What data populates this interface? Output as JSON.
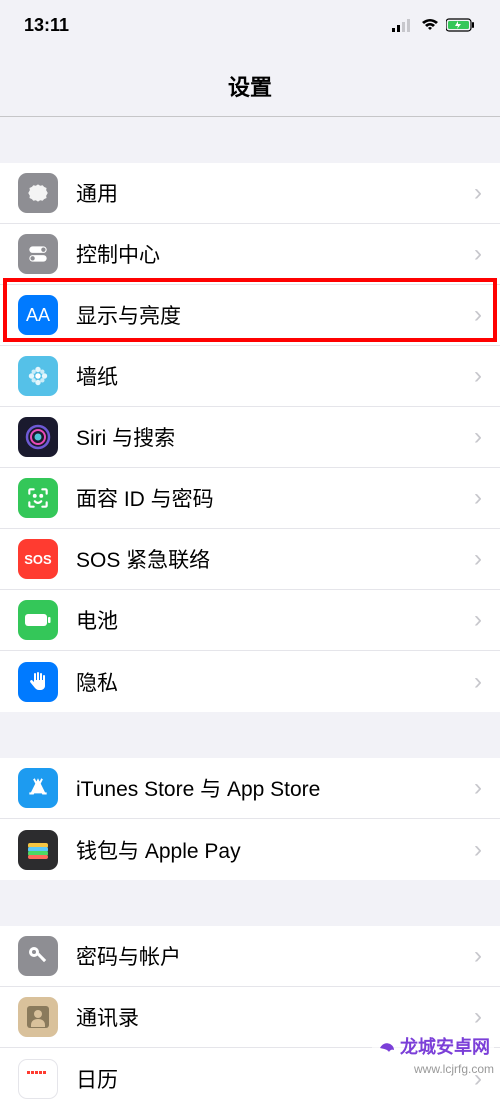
{
  "status": {
    "time": "13:11"
  },
  "header": {
    "title": "设置"
  },
  "groups": [
    [
      {
        "label": "通用",
        "icon": "general"
      },
      {
        "label": "控制中心",
        "icon": "control"
      },
      {
        "label": "显示与亮度",
        "icon": "display",
        "highlighted": true
      },
      {
        "label": "墙纸",
        "icon": "wallpaper"
      },
      {
        "label": "Siri 与搜索",
        "icon": "siri"
      },
      {
        "label": "面容 ID 与密码",
        "icon": "faceid"
      },
      {
        "label": "SOS 紧急联络",
        "icon": "sos"
      },
      {
        "label": "电池",
        "icon": "battery"
      },
      {
        "label": "隐私",
        "icon": "privacy"
      }
    ],
    [
      {
        "label": "iTunes Store 与 App Store",
        "icon": "appstore"
      },
      {
        "label": "钱包与 Apple Pay",
        "icon": "wallet"
      }
    ],
    [
      {
        "label": "密码与帐户",
        "icon": "passwords"
      },
      {
        "label": "通讯录",
        "icon": "contacts"
      },
      {
        "label": "日历",
        "icon": "calendar"
      }
    ]
  ],
  "watermark": {
    "text": "龙城安卓网",
    "url": "www.lcjrfg.com"
  }
}
